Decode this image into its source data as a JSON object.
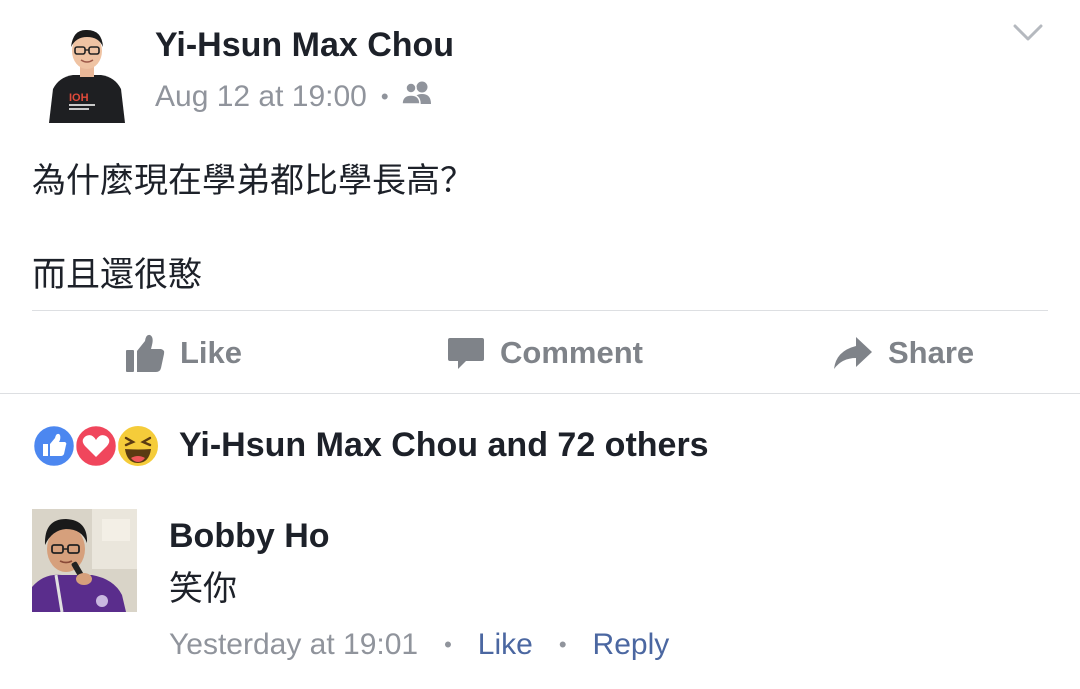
{
  "post": {
    "author": "Yi-Hsun Max Chou",
    "timestamp": "Aug 12 at 19:00",
    "audience_icon": "friends-icon",
    "lines": [
      "為什麼現在學弟都比學長高？",
      "而且還很憨"
    ],
    "avatar_shirt_text": "IOH"
  },
  "actions": {
    "like_label": "Like",
    "comment_label": "Comment",
    "share_label": "Share"
  },
  "reactions": {
    "icons": [
      "like-reaction-icon",
      "love-reaction-icon",
      "haha-reaction-icon"
    ],
    "summary": "Yi-Hsun Max Chou and 72 others"
  },
  "comment": {
    "author": "Bobby Ho",
    "text": "笑你",
    "timestamp": "Yesterday at 19:01",
    "like_label": "Like",
    "reply_label": "Reply"
  },
  "colors": {
    "text": "#1d2129",
    "muted": "#90949c",
    "action_gray": "#7f8389",
    "link": "#4b67a1",
    "divider": "#dddfe2",
    "like_blue": "#4c87f0",
    "love_red": "#f0465c",
    "haha_yellow": "#f5cc3a"
  }
}
